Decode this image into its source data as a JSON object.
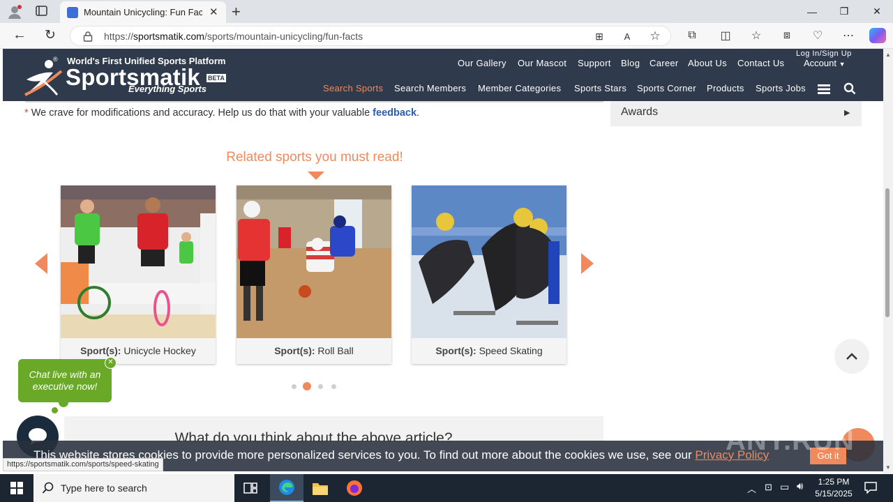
{
  "browser": {
    "tab_title": "Mountain Unicycling: Fun Facts, ",
    "url_prefix": "https://",
    "url_domain": "sportsmatik.com",
    "url_path": "/sports/mountain-unicycling/fun-facts",
    "status_url": "https://sportsmatik.com/sports/speed-skating"
  },
  "header": {
    "tagline": "World's First Unified Sports Platform",
    "logo": "Sportsmatik",
    "beta": "BETA",
    "slogan": "Everything Sports",
    "login": "Log In/Sign Up",
    "account": "Account",
    "top_nav": [
      "Our Gallery",
      "Our Mascot",
      "Support",
      "Blog",
      "Career",
      "About Us",
      "Contact Us"
    ],
    "main_nav": [
      "Search Sports",
      "Search Members",
      "Member Categories",
      "Sports Stars",
      "Sports Corner",
      "Products",
      "Sports Jobs"
    ]
  },
  "feedback": {
    "asterisk": "*",
    "text": "We crave for modifications and accuracy. Help us do that with your valuable",
    "link": "feedback",
    "period": "."
  },
  "sidebar": {
    "awards": "Awards"
  },
  "related": {
    "heading": "Related sports you must read!",
    "label_prefix": "Sport(s):",
    "cards": [
      {
        "sport": "Unicycle Hockey"
      },
      {
        "sport": "Roll Ball"
      },
      {
        "sport": "Speed Skating"
      }
    ],
    "active_dot": 2
  },
  "chat": {
    "text": "Chat live with an executive now!"
  },
  "article_question": "What do you think about the above article?",
  "cookie": {
    "text": "This website stores cookies to provide more personalized services to you. To find out more about the cookies we use, see our",
    "link": "Privacy Policy",
    "button": "Got it"
  },
  "watermark": "ANY.RUN",
  "taskbar": {
    "search_placeholder": "Type here to search",
    "time": "1:25 PM",
    "date": "5/15/2025"
  },
  "colors": {
    "accent": "#f08a5d",
    "header_bg": "#2f3b4d",
    "chat_green": "#6aa827"
  }
}
